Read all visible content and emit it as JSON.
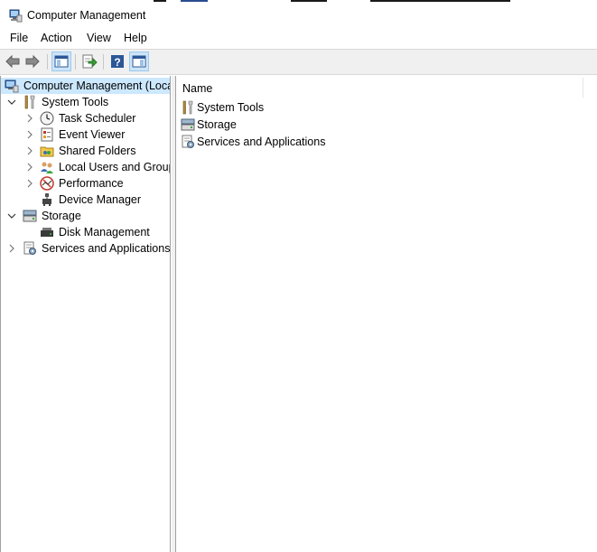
{
  "window": {
    "title": "Computer Management"
  },
  "menu": {
    "file": "File",
    "action": "Action",
    "view": "View",
    "help": "Help"
  },
  "toolbar": {
    "buttons": [
      "back-icon",
      "forward-icon",
      "show-hide-console-tree-icon",
      "export-list-icon",
      "help-icon",
      "show-hide-action-pane-icon"
    ]
  },
  "tree": {
    "root": "Computer Management (Local",
    "system_tools": "System Tools",
    "task_scheduler": "Task Scheduler",
    "event_viewer": "Event Viewer",
    "shared_folders": "Shared Folders",
    "local_users": "Local Users and Groups",
    "performance": "Performance",
    "device_manager": "Device Manager",
    "storage": "Storage",
    "disk_management": "Disk Management",
    "services_apps": "Services and Applications"
  },
  "list": {
    "column_name": "Name",
    "items": [
      "System Tools",
      "Storage",
      "Services and Applications"
    ]
  },
  "colors": {
    "selection": "#cce8ff",
    "toolbar_bg": "#f0f0f0",
    "pane_border": "#a0a0a0"
  }
}
